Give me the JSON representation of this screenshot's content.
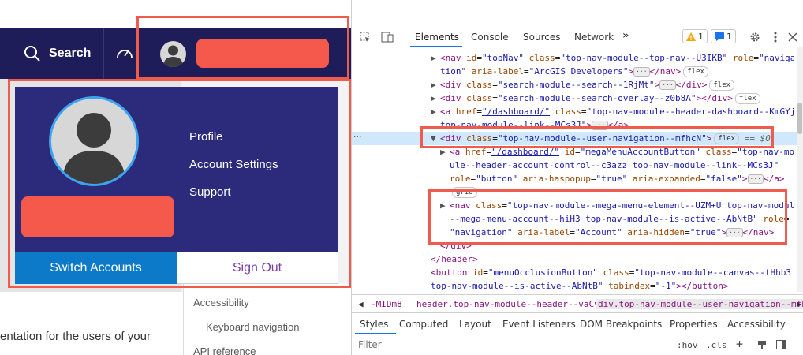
{
  "site": {
    "nav": {
      "search_label": "Search"
    },
    "mega_menu": {
      "links": [
        "Profile",
        "Account Settings",
        "Support"
      ],
      "switch_accounts": "Switch Accounts",
      "sign_out": "Sign Out"
    },
    "doc_text": "entation for the users of your",
    "sidebar_links": [
      "Accessibility",
      "Keyboard navigation",
      "API reference"
    ]
  },
  "devtools": {
    "tabs": [
      "Elements",
      "Console",
      "Sources",
      "Network"
    ],
    "more_tabs": "»",
    "warnings": "1",
    "messages": "1",
    "lines": [
      {
        "content": "<nav id=\"topNav\" class=\"top-nav-module--top-nav--U3IKB\" role=\"naviga"
      },
      {
        "content": "tion\" aria-label=\"ArcGIS Developers\">…</nav> flex"
      },
      {
        "content": "<div class=\"search-module--search--1RjMt\">…</div> flex"
      },
      {
        "content": "<div class=\"search-module--search-overlay--z0b8A\"></div> flex"
      },
      {
        "content": "<a href=\"/dashboard/\" class=\"top-nav-module--header-dashboard--KmGYj"
      },
      {
        "content": "top-nav-module--link--MCs3J\">…</a>"
      },
      {
        "content": "<div class=\"top-nav-module--user-navigation--mfhcN\"> flex == $0"
      },
      {
        "content": "<a href=\"/dashboard/\" id=\"megaMenuAccountButton\" class=\"top-nav-mod"
      },
      {
        "content": "ule--header-account-control--c3azz top-nav-module--link--MCs3J\""
      },
      {
        "content": "role=\"button\" aria-haspopup=\"true\" aria-expanded=\"false\">…</a>"
      },
      {
        "content": "grid"
      },
      {
        "content": "<nav class=\"top-nav-module--mega-menu-element--UZM+U top-nav-module"
      },
      {
        "content": "--mega-menu-account--hiH3 top-nav-module--is-active--AbNtB\" role="
      },
      {
        "content": "\"navigation\" aria-label=\"Account\" aria-hidden=\"true\">…</nav>"
      },
      {
        "content": "</div>"
      },
      {
        "content": "</header>"
      },
      {
        "content": "<button id=\"menuOcclusionButton\" class=\"top-nav-module--canvas--tHhb3"
      },
      {
        "content": "top-nav-module--is-active--AbNtB\" tabindex=\"-1\"></button>"
      }
    ],
    "breadcrumbs": [
      "-MIDm8",
      "header.top-nav-module--header--vaCva",
      "div.top-nav-module--user-navigation--mfhcN"
    ],
    "sub_tabs": [
      "Styles",
      "Computed",
      "Layout",
      "Event Listeners",
      "DOM Breakpoints",
      "Properties",
      "Accessibility"
    ],
    "filter_placeholder": "Filter",
    "filter_tools": {
      "hov": ":hov",
      "cls": ".cls",
      "plus": "+"
    }
  },
  "colors": {
    "nav_bg": "#1f1c5a",
    "mega_bg": "#2c2a7a",
    "switch_btn": "#0c7ac9",
    "sign_out_text": "#7b3fa8",
    "highlight_box": "#ef5c4e",
    "redaction": "#f4594b"
  }
}
